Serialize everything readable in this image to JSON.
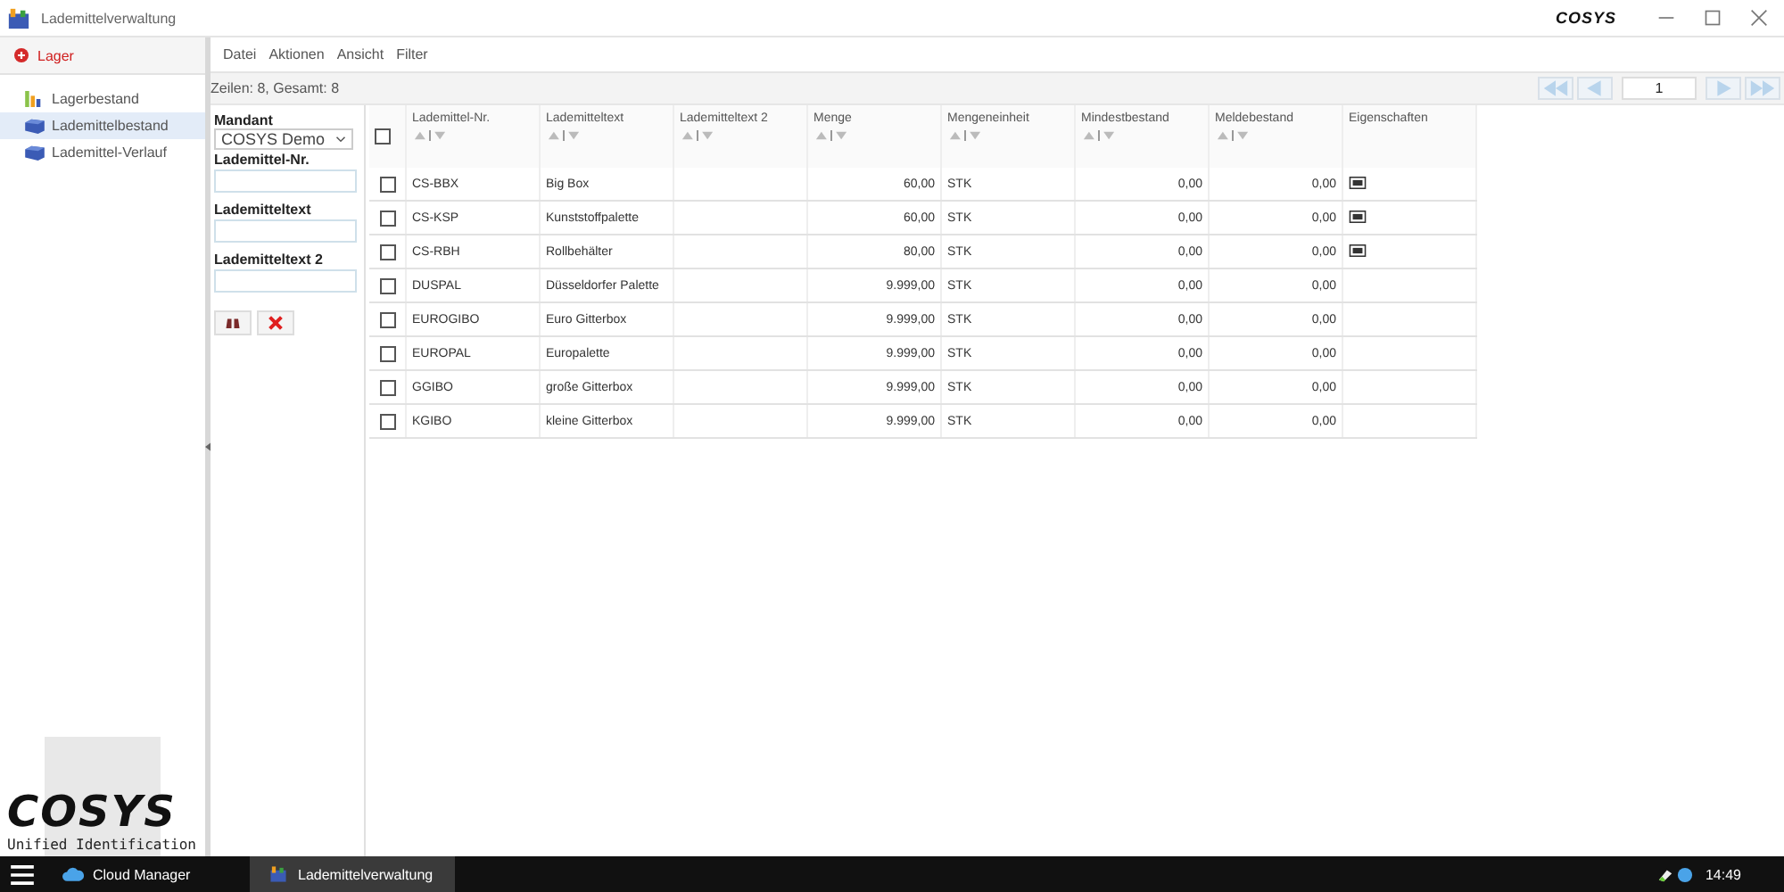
{
  "window": {
    "title": "Lademittelverwaltung",
    "logo": "COSYS"
  },
  "sidebar": {
    "header": "Lager",
    "items": [
      {
        "label": "Lagerbestand",
        "selected": false,
        "kind": "chart"
      },
      {
        "label": "Lademittelbestand",
        "selected": true,
        "kind": "box"
      },
      {
        "label": "Lademittel-Verlauf",
        "selected": false,
        "kind": "box"
      }
    ],
    "brand": {
      "logo": "COSYS",
      "tagline": "Unified Identification"
    }
  },
  "menu": [
    "Datei",
    "Aktionen",
    "Ansicht",
    "Filter"
  ],
  "status": "Zeilen: 8, Gesamt: 8",
  "pager": {
    "page": "1"
  },
  "filter": {
    "mandant_label": "Mandant",
    "mandant_value": "COSYS Demo",
    "fields": [
      {
        "label": "Lademittel-Nr."
      },
      {
        "label": "Lademitteltext"
      },
      {
        "label": "Lademitteltext 2"
      }
    ]
  },
  "table": {
    "all_checked": false,
    "columns": [
      {
        "label": "Lademittel-Nr.",
        "sortable": true,
        "kind": "text"
      },
      {
        "label": "Lademitteltext",
        "sortable": true,
        "kind": "text"
      },
      {
        "label": "Lademitteltext 2",
        "sortable": true,
        "kind": "text"
      },
      {
        "label": "Menge",
        "sortable": true,
        "kind": "number"
      },
      {
        "label": "Mengeneinheit",
        "sortable": true,
        "kind": "text"
      },
      {
        "label": "Mindestbestand",
        "sortable": true,
        "kind": "number"
      },
      {
        "label": "Meldebestand",
        "sortable": true,
        "kind": "number"
      },
      {
        "label": "Eigenschaften",
        "sortable": false,
        "kind": "icon"
      }
    ],
    "rows": [
      {
        "checked": false,
        "cells": [
          "CS-BBX",
          "Big Box",
          "",
          "60,00",
          "STK",
          "0,00",
          "0,00"
        ],
        "property_icon": true
      },
      {
        "checked": false,
        "cells": [
          "CS-KSP",
          "Kunststoffpalette",
          "",
          "60,00",
          "STK",
          "0,00",
          "0,00"
        ],
        "property_icon": true
      },
      {
        "checked": false,
        "cells": [
          "CS-RBH",
          "Rollbehälter",
          "",
          "80,00",
          "STK",
          "0,00",
          "0,00"
        ],
        "property_icon": true
      },
      {
        "checked": false,
        "cells": [
          "DUSPAL",
          "Düsseldorfer Palette",
          "",
          "9.999,00",
          "STK",
          "0,00",
          "0,00"
        ],
        "property_icon": false
      },
      {
        "checked": false,
        "cells": [
          "EUROGIBO",
          "Euro Gitterbox",
          "",
          "9.999,00",
          "STK",
          "0,00",
          "0,00"
        ],
        "property_icon": false
      },
      {
        "checked": false,
        "cells": [
          "EUROPAL",
          "Europalette",
          "",
          "9.999,00",
          "STK",
          "0,00",
          "0,00"
        ],
        "property_icon": false
      },
      {
        "checked": false,
        "cells": [
          "GGIBO",
          "große Gitterbox",
          "",
          "9.999,00",
          "STK",
          "0,00",
          "0,00"
        ],
        "property_icon": false
      },
      {
        "checked": false,
        "cells": [
          "KGIBO",
          "kleine Gitterbox",
          "",
          "9.999,00",
          "STK",
          "0,00",
          "0,00"
        ],
        "property_icon": false
      }
    ]
  },
  "taskbar": {
    "items": [
      {
        "label": "Cloud Manager",
        "selected": false,
        "kind": "cloud"
      },
      {
        "label": "Lademittelverwaltung",
        "selected": true,
        "kind": "app"
      }
    ],
    "clock": "14:49"
  }
}
